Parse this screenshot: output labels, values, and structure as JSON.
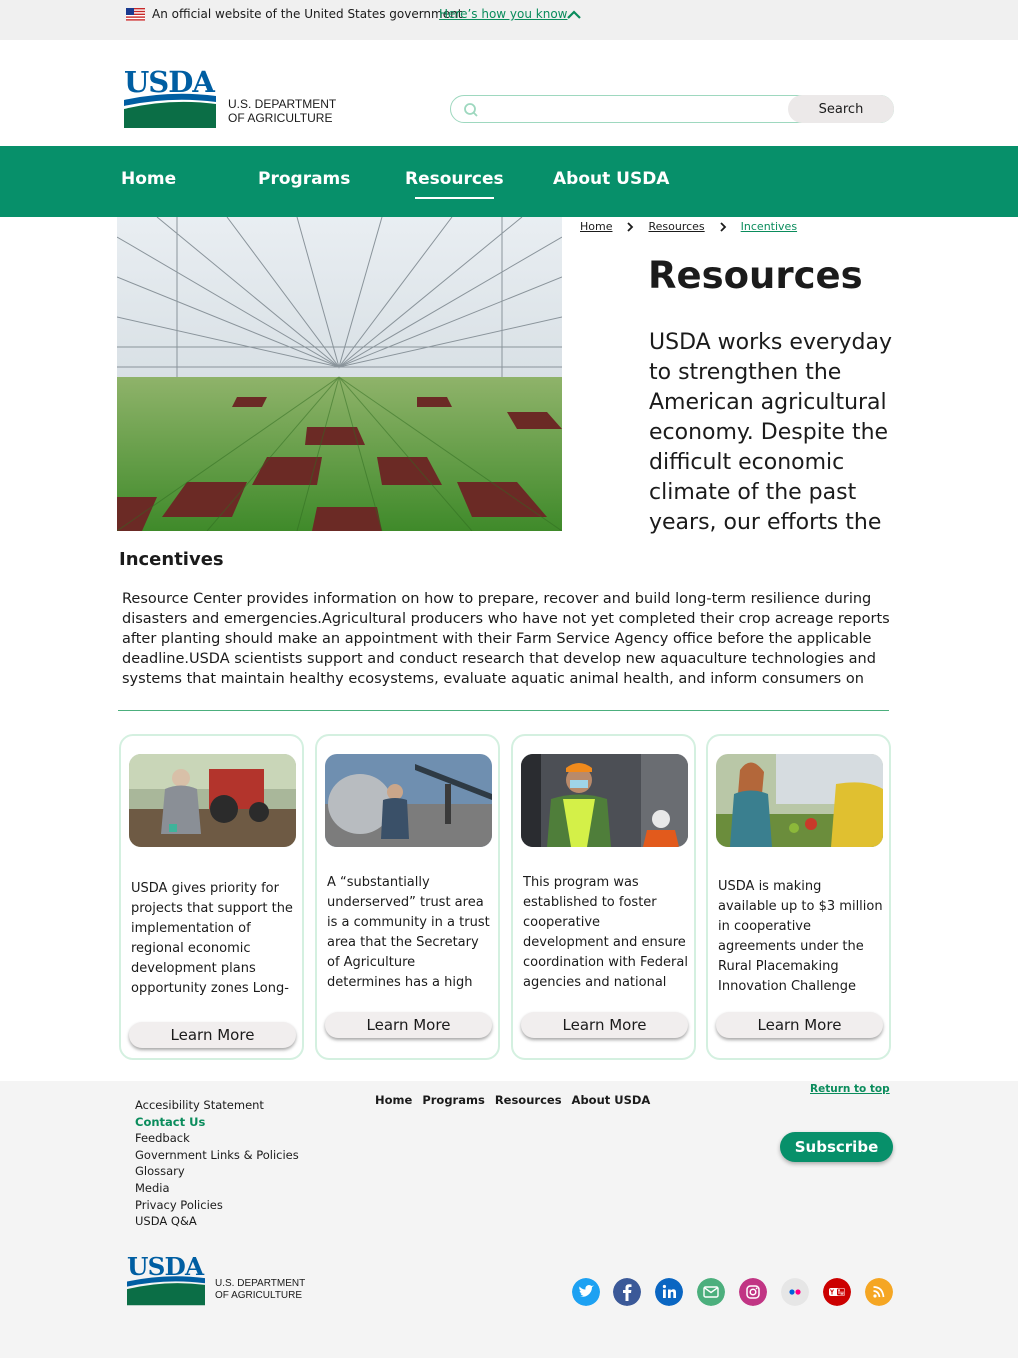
{
  "gov_banner": {
    "text": "An official website of the United States government",
    "link": "Here’s how you know"
  },
  "header": {
    "logo_text": "USDA",
    "dept_line1": "U.S. DEPARTMENT",
    "dept_line2": "OF AGRICULTURE",
    "search": {
      "value": "",
      "placeholder": "",
      "button": "Search"
    }
  },
  "nav": {
    "items": [
      "Home",
      "Programs",
      "Resources",
      "About USDA"
    ],
    "active": "Resources"
  },
  "breadcrumb": [
    "Home",
    "Resources",
    "Incentives"
  ],
  "page": {
    "title": "Resources",
    "intro": "USDA works everyday to strengthen the American agricultural economy. Despite the difficult economic climate of the past years, our efforts the",
    "section_title": "Incentives",
    "section_body": "Resource Center provides information on how to prepare, recover and build long-term resilience during disasters and emergencies.Agricultural producers who have not yet completed their crop acreage reports after planting should make an appointment with their Farm Service Agency office before the applicable deadline.USDA scientists support and conduct research that develop new aquaculture technologies and systems that maintain healthy ecosystems, evaluate aquatic animal health, and inform consumers on the"
  },
  "cards": [
    {
      "text": "USDA gives priority for projects that support the implementation of regional economic development plans opportunity zones Long-",
      "button": "Learn More"
    },
    {
      "text": "A “substantially underserved” trust area is a community in a trust area that the Secretary of Agriculture determines has a high need for",
      "button": "Learn More"
    },
    {
      "text": "This program was established to foster cooperative development and ensure coordination with Federal agencies and national and local",
      "button": "Learn More"
    },
    {
      "text": "USDA is making available up to $3 million in cooperative agreements under the Rural Placemaking Innovation Challenge (RPIC) for",
      "button": "Learn More"
    }
  ],
  "footer": {
    "links": [
      "Accesibility Statement",
      "Contact Us",
      "Feedback",
      "Government Links & Policies",
      "Glossary",
      "Media",
      "Privacy Policies",
      "USDA Q&A"
    ],
    "nav": [
      "Home",
      "Programs",
      "Resources",
      "About USDA"
    ],
    "return_top": "Return to top",
    "subscribe": "Subscribe",
    "logo_text": "USDA",
    "dept_line1": "U.S. DEPARTMENT",
    "dept_line2": "OF AGRICULTURE",
    "social": [
      {
        "icon": "twitter-icon",
        "color": "#1da1f2"
      },
      {
        "icon": "facebook-icon",
        "color": "#3b5998"
      },
      {
        "icon": "linkedin-icon",
        "color": "#0a66c2"
      },
      {
        "icon": "email-icon",
        "color": "#4caf7d"
      },
      {
        "icon": "instagram-icon",
        "color": "#c13584"
      },
      {
        "icon": "flickr-icon",
        "color": "#e6e6e6"
      },
      {
        "icon": "youtube-icon",
        "color": "#cc0000"
      },
      {
        "icon": "rss-icon",
        "color": "#f5a623"
      }
    ]
  },
  "colors": {
    "brand_green": "#07906a",
    "link_green": "#0a8c5c",
    "usda_blue": "#005ea2"
  }
}
